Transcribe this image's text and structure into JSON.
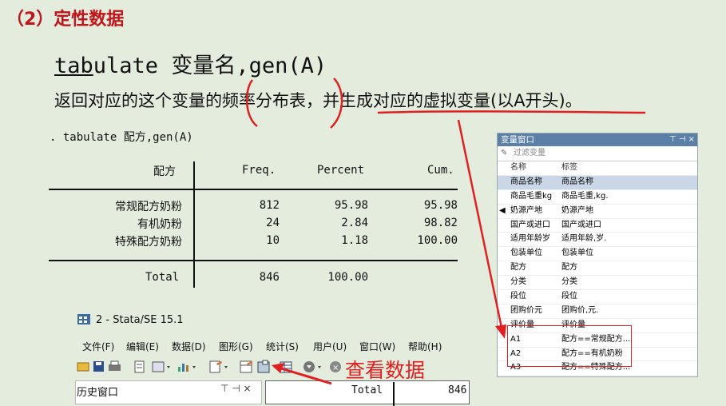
{
  "heading": "（2）定性数据",
  "command": {
    "underlined": "tab",
    "rest": "ulate 变量名,gen(A)"
  },
  "description": {
    "part1": "返回对应的这个变量的",
    "part2": "频率分布表",
    "part3": "，",
    "part4": "并生成对应的虚拟变量(以A开头)",
    "part5": "。"
  },
  "stata_output": {
    "command_line": ". tabulate 配方,gen(A)",
    "headers": [
      "配方",
      "Freq.",
      "Percent",
      "Cum."
    ],
    "rows": [
      {
        "label": "常规配方奶粉",
        "freq": "812",
        "percent": "95.98",
        "cum": "95.98"
      },
      {
        "label": "有机奶粉",
        "freq": "24",
        "percent": "2.84",
        "cum": "98.82"
      },
      {
        "label": "特殊配方奶粉",
        "freq": "10",
        "percent": "1.18",
        "cum": "100.00"
      }
    ],
    "total": {
      "label": "Total",
      "freq": "846",
      "percent": "100.00"
    }
  },
  "variables_window": {
    "title": "变量窗口",
    "controls": "⊤ ⊣ ×",
    "filter_placeholder": "过滤变量",
    "col_name": "名称",
    "col_label": "标签",
    "rows": [
      {
        "name": "商品名称",
        "label": "商品名称"
      },
      {
        "name": "商品毛重kg",
        "label": "商品毛重,kg."
      },
      {
        "name": "奶源产地",
        "label": "奶源产地"
      },
      {
        "name": "国产或进口",
        "label": "国产或进口"
      },
      {
        "name": "适用年龄岁",
        "label": "适用年龄,岁."
      },
      {
        "name": "包装单位",
        "label": "包装单位"
      },
      {
        "name": "配方",
        "label": "配方"
      },
      {
        "name": "分类",
        "label": "分类"
      },
      {
        "name": "段位",
        "label": "段位"
      },
      {
        "name": "团购价元",
        "label": "团购价,元."
      },
      {
        "name": "评价量",
        "label": "评价量"
      },
      {
        "name": "A1",
        "label": "配方==常规配方..."
      },
      {
        "name": "A2",
        "label": "配方==有机奶粉"
      },
      {
        "name": "A3",
        "label": "配方==特殊配方..."
      }
    ]
  },
  "stata_window": {
    "title": "2 - Stata/SE 15.1",
    "menus": [
      "文件(F)",
      "编辑(E)",
      "数据(D)",
      "图形(G)",
      "统计(S)",
      "用户(U)",
      "窗口(W)",
      "帮助(H)"
    ],
    "annotation": "查看数据",
    "history_title": "历史窗口",
    "history_controls": "⊤ ⊣ ×",
    "results_total_label": "Total",
    "results_total_value": "846"
  },
  "colors": {
    "accent_red": "#c0151a",
    "annotation_red": "#e02020",
    "background": "#e3ecdd"
  }
}
